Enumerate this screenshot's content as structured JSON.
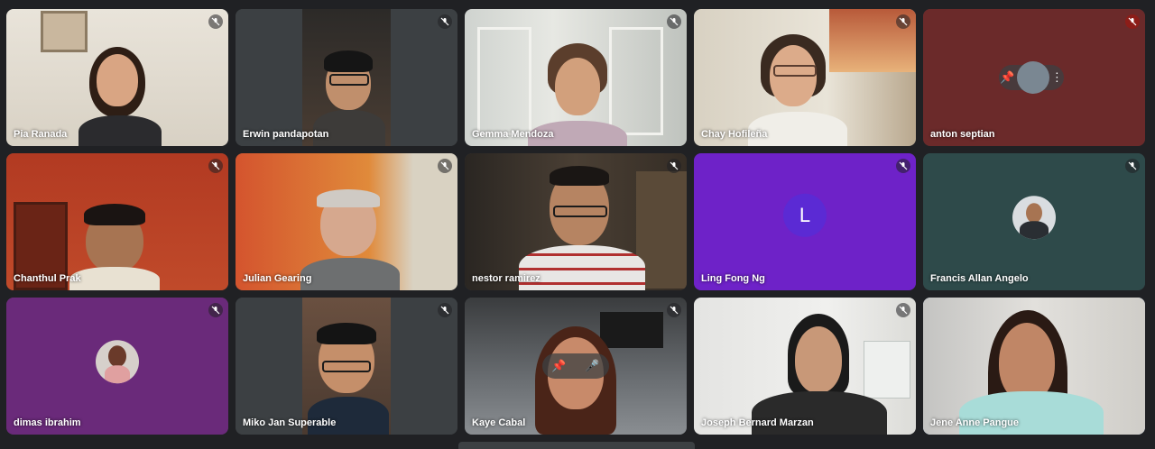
{
  "participants": [
    {
      "name": "Pia Ranada"
    },
    {
      "name": "Erwin pandapotan"
    },
    {
      "name": "Gemma Mendoza"
    },
    {
      "name": "Chay Hofileña"
    },
    {
      "name": "anton septian"
    },
    {
      "name": "Chanthul Prak"
    },
    {
      "name": "Julian Gearing"
    },
    {
      "name": "nestor ramirez"
    },
    {
      "name": "Ling Fong Ng",
      "avatar_letter": "L"
    },
    {
      "name": "Francis Allan Angelo"
    },
    {
      "name": "dimas ibrahim"
    },
    {
      "name": "Miko Jan Superable"
    },
    {
      "name": "Kaye Cabal"
    },
    {
      "name": "Joseph Bernard Marzan"
    },
    {
      "name": "Jene Anne Pangue"
    }
  ],
  "icons": {
    "muted": "mic-off-icon",
    "pin": "pin-icon",
    "more": "more-vert-icon"
  },
  "colors": {
    "background": "#202124",
    "muted_red": "#8c1d18",
    "speaker_border": "#a8c7fa"
  }
}
